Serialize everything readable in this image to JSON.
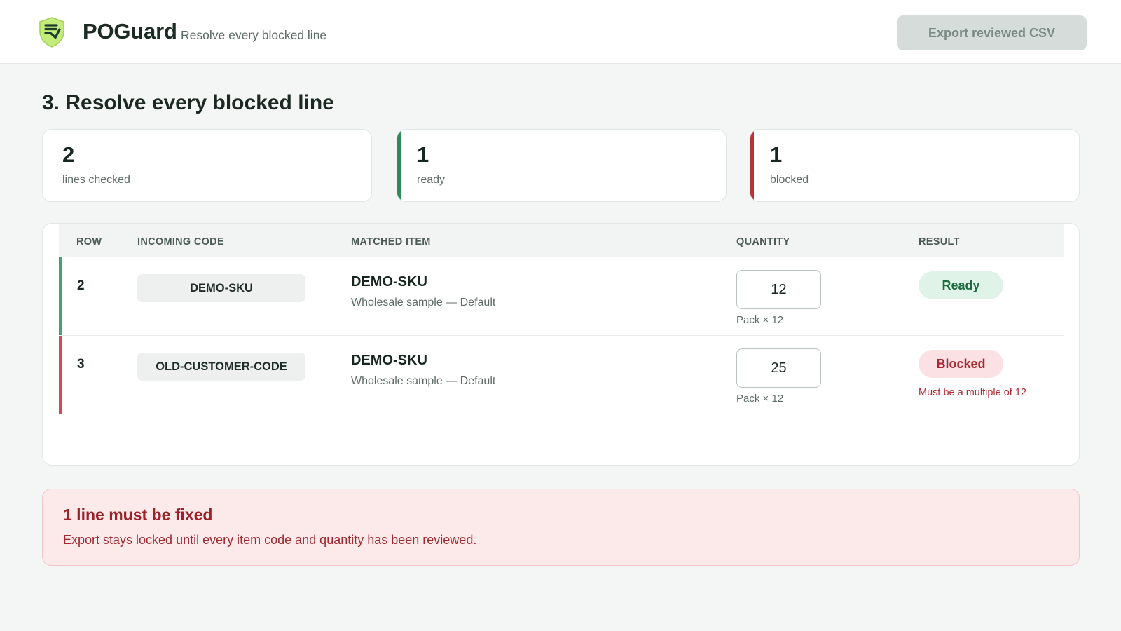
{
  "app": {
    "name": "POGuard",
    "subtitle": "Resolve every blocked line",
    "export_label": "Export reviewed CSV"
  },
  "page": {
    "title": "3. Resolve every blocked line"
  },
  "stats": [
    {
      "value": "2",
      "label": "lines checked",
      "accent": null
    },
    {
      "value": "1",
      "label": "ready",
      "accent": "#2e8b57"
    },
    {
      "value": "1",
      "label": "blocked",
      "accent": "#b8323a"
    }
  ],
  "table": {
    "headers": {
      "row": "ROW",
      "incoming_code": "INCOMING CODE",
      "matched_item": "MATCHED ITEM",
      "quantity": "QUANTITY",
      "result": "RESULT"
    },
    "rows": [
      {
        "row": "2",
        "incoming_code": "DEMO-SKU",
        "item_name": "DEMO-SKU",
        "item_desc": "Wholesale sample — Default",
        "quantity": "12",
        "pack": "Pack × 12",
        "status": "Ready",
        "status_color": "#4aa06d",
        "error": ""
      },
      {
        "row": "3",
        "incoming_code": "OLD-CUSTOMER-CODE",
        "item_name": "DEMO-SKU",
        "item_desc": "Wholesale sample — Default",
        "quantity": "25",
        "pack": "Pack × 12",
        "status": "Blocked",
        "status_color": "#d04c52",
        "error": "Must be a multiple of 12"
      }
    ]
  },
  "alert": {
    "title": "1 line must be fixed",
    "body": "Export stays locked until every item code and quantity has been reviewed."
  },
  "colors": {
    "logo_fill": "#c3ec7b",
    "logo_dark": "#1f3d2b",
    "ready": "#2e8b57",
    "blocked": "#b8323a"
  },
  "icons": {
    "logo": "shield-check-icon"
  }
}
